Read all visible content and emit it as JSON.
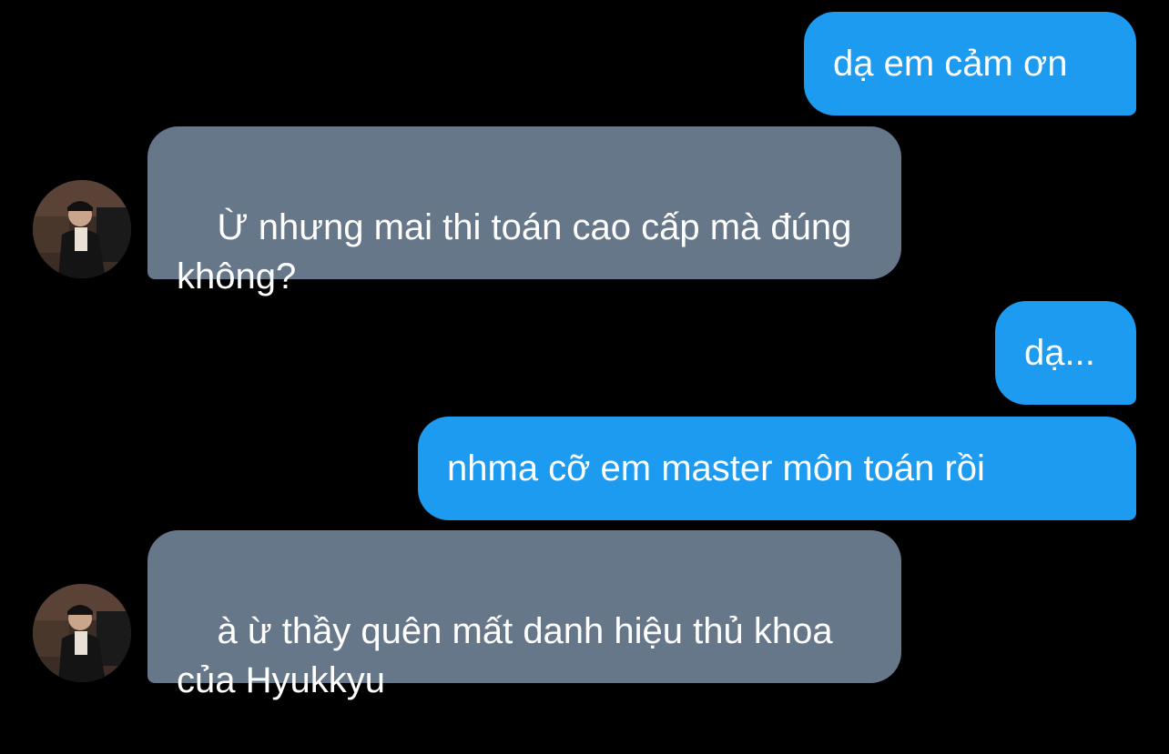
{
  "messages": [
    {
      "direction": "outgoing",
      "text": "dạ em cảm ơn"
    },
    {
      "direction": "incoming",
      "text": "Ừ nhưng mai thi toán cao cấp mà đúng không?"
    },
    {
      "direction": "outgoing",
      "text": "dạ..."
    },
    {
      "direction": "outgoing",
      "text": "nhma cỡ em master môn toán rồi"
    },
    {
      "direction": "incoming",
      "text": "à ừ thầy quên mất danh hiệu thủ khoa của Hyukkyu"
    }
  ],
  "colors": {
    "background": "#000000",
    "outgoing_bubble": "#1d9bf0",
    "incoming_bubble": "#66778a",
    "text": "#ffffff"
  },
  "icons": {
    "avatar": "user-avatar-photo"
  }
}
